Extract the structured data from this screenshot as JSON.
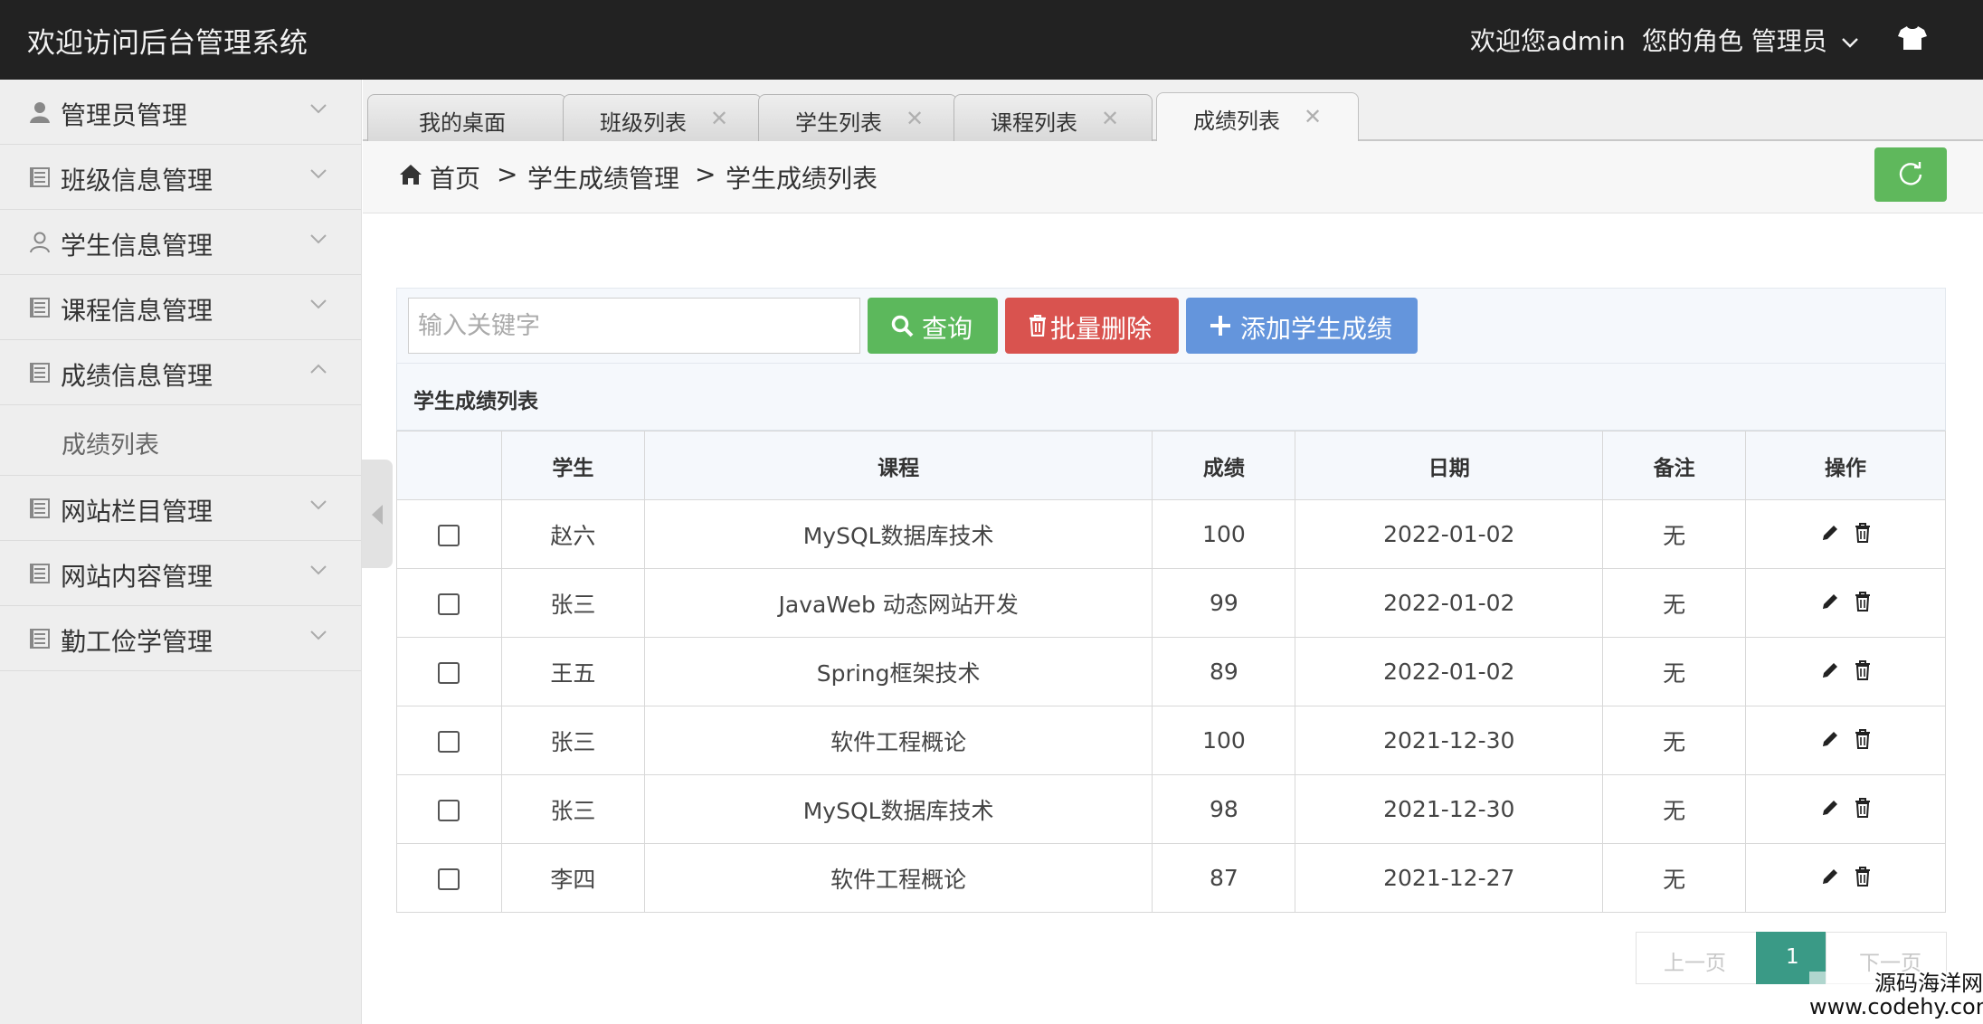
{
  "header": {
    "title": "欢迎访问后台管理系统",
    "welcome": "欢迎您admin",
    "role": "您的角色  管理员"
  },
  "sidebar": {
    "items": [
      {
        "label": "管理员管理",
        "icon": "user-icon",
        "expanded": false
      },
      {
        "label": "班级信息管理",
        "icon": "list-icon",
        "expanded": false
      },
      {
        "label": "学生信息管理",
        "icon": "user-outline-icon",
        "expanded": false
      },
      {
        "label": "课程信息管理",
        "icon": "list-icon",
        "expanded": false
      },
      {
        "label": "成绩信息管理",
        "icon": "list-icon",
        "expanded": true,
        "children": [
          {
            "label": "成绩列表"
          }
        ]
      },
      {
        "label": "网站栏目管理",
        "icon": "list-icon",
        "expanded": false
      },
      {
        "label": "网站内容管理",
        "icon": "list-icon",
        "expanded": false
      },
      {
        "label": "勤工俭学管理",
        "icon": "list-icon",
        "expanded": false
      }
    ]
  },
  "tabs": [
    {
      "label": "我的桌面",
      "closable": false
    },
    {
      "label": "班级列表",
      "closable": true
    },
    {
      "label": "学生列表",
      "closable": true
    },
    {
      "label": "课程列表",
      "closable": true
    },
    {
      "label": "成绩列表",
      "closable": true,
      "active": true
    }
  ],
  "breadcrumb": {
    "home": "首页",
    "sep": ">",
    "level1": "学生成绩管理",
    "level2": "学生成绩列表"
  },
  "toolbar": {
    "search_placeholder": "输入关键字",
    "search_value": "",
    "query_label": "查询",
    "batch_delete_label": "批量删除",
    "add_label": "添加学生成绩"
  },
  "panel": {
    "title": "学生成绩列表"
  },
  "table": {
    "headers": [
      "",
      "学生",
      "课程",
      "成绩",
      "日期",
      "备注",
      "操作"
    ],
    "rows": [
      {
        "student": "赵六",
        "course": "MySQL数据库技术",
        "score": "100",
        "date": "2022-01-02",
        "note": "无"
      },
      {
        "student": "张三",
        "course": "JavaWeb 动态网站开发",
        "score": "99",
        "date": "2022-01-02",
        "note": "无"
      },
      {
        "student": "王五",
        "course": "Spring框架技术",
        "score": "89",
        "date": "2022-01-02",
        "note": "无"
      },
      {
        "student": "张三",
        "course": "软件工程概论",
        "score": "100",
        "date": "2021-12-30",
        "note": "无"
      },
      {
        "student": "张三",
        "course": "MySQL数据库技术",
        "score": "98",
        "date": "2021-12-30",
        "note": "无"
      },
      {
        "student": "李四",
        "course": "软件工程概论",
        "score": "87",
        "date": "2021-12-27",
        "note": "无"
      }
    ]
  },
  "pager": {
    "prev": "上一页",
    "current": "1",
    "next": "下一页"
  },
  "watermark": {
    "line1": "源码海洋网",
    "line2": "www.codehy.com"
  },
  "colors": {
    "header_bg": "#222222",
    "query_btn": "#5cb85c",
    "delete_btn": "#d9534f",
    "add_btn": "#6495dc",
    "refresh_btn": "#5fb85c",
    "current_page": "#3a9a86"
  }
}
